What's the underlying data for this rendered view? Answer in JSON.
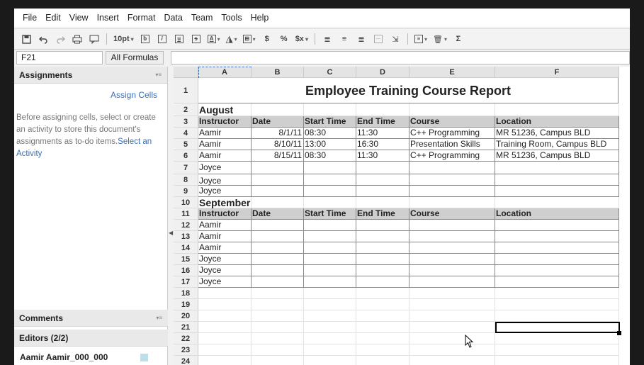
{
  "menu": [
    "File",
    "Edit",
    "View",
    "Insert",
    "Format",
    "Data",
    "Team",
    "Tools",
    "Help"
  ],
  "toolbar": {
    "font_size": "10pt"
  },
  "formula_bar": {
    "cell_ref": "F21",
    "all_formulas_label": "All Formulas"
  },
  "panel": {
    "assignments_title": "Assignments",
    "assign_cells_link": "Assign Cells",
    "assign_desc": "Before assigning cells, select or create an activity to store this document's assignments as to-do items.",
    "select_activity_link": "Select an Activity",
    "comments_title": "Comments",
    "editors_title": "Editors (2/2)",
    "editor_name": "Aamir Aamir_000_000"
  },
  "sheet": {
    "columns": [
      "A",
      "B",
      "C",
      "D",
      "E",
      "F"
    ],
    "rows": [
      "1",
      "2",
      "3",
      "4",
      "5",
      "6",
      "7",
      "8",
      "9",
      "10",
      "11",
      "12",
      "13",
      "14",
      "15",
      "16",
      "17",
      "18",
      "19",
      "20",
      "21",
      "22",
      "23",
      "24"
    ],
    "title": "Employee Training Course Report",
    "august": "August",
    "september": "September",
    "headers": [
      "Instructor",
      "Date",
      "Start Time",
      "End Time",
      "Course",
      "Location"
    ],
    "august_rows": [
      [
        "Aamir",
        "8/1/11",
        "08:30",
        "11:30",
        "C++ Programming",
        "MR 51236, Campus BLD"
      ],
      [
        "Aamir",
        "8/10/11",
        "13:00",
        "16:30",
        "Presentation Skills",
        "Training Room, Campus BLD"
      ],
      [
        "Aamir",
        "8/15/11",
        "08:30",
        "11:30",
        "C++ Programming",
        "MR 51236, Campus BLD"
      ],
      [
        "Joyce",
        "",
        "",
        "",
        "",
        ""
      ],
      [
        "Joyce",
        "",
        "",
        "",
        "",
        ""
      ],
      [
        "Joyce",
        "",
        "",
        "",
        "",
        ""
      ]
    ],
    "september_rows": [
      [
        "Aamir",
        "",
        "",
        "",
        "",
        ""
      ],
      [
        "Aamir",
        "",
        "",
        "",
        "",
        ""
      ],
      [
        "Aamir",
        "",
        "",
        "",
        "",
        ""
      ],
      [
        "Joyce",
        "",
        "",
        "",
        "",
        ""
      ],
      [
        "Joyce",
        "",
        "",
        "",
        "",
        ""
      ],
      [
        "Joyce",
        "",
        "",
        "",
        "",
        ""
      ]
    ]
  },
  "colors": {
    "link": "#3a6fb5",
    "header_fill": "#cfcfcf",
    "editor_swatch": "#bcdfe9"
  }
}
